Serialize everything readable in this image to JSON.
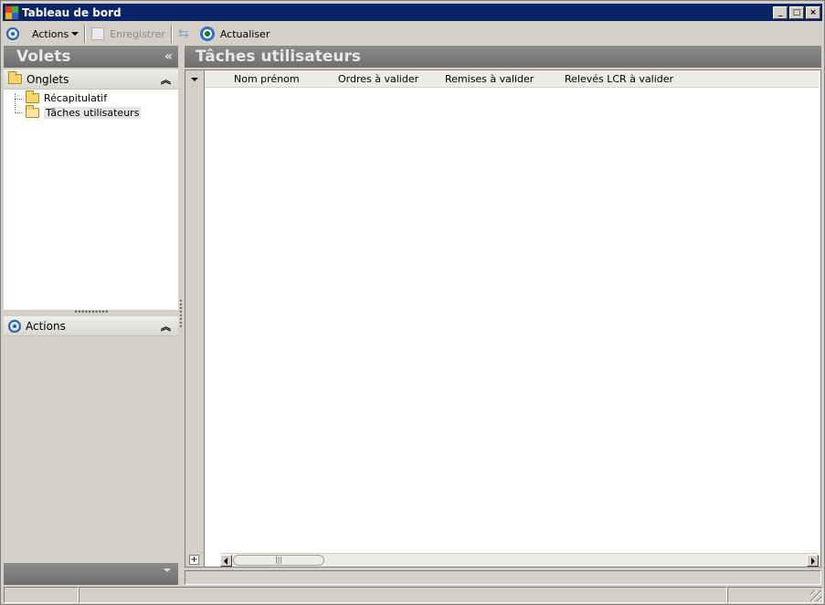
{
  "window": {
    "title": "Tableau de bord"
  },
  "toolbar": {
    "actions_label": "Actions",
    "save_label": "Enregistrer",
    "refresh_label": "Actualiser"
  },
  "left": {
    "header": "Volets",
    "collapse_glyph": "«",
    "tabs_section": {
      "title": "Onglets",
      "items": [
        {
          "label": "Récapitulatif"
        },
        {
          "label": "Tâches utilisateurs",
          "selected": true
        }
      ]
    },
    "actions_section": {
      "title": "Actions"
    }
  },
  "main": {
    "title": "Tâches utilisateurs",
    "columns": [
      "Nom prénom",
      "Ordres à valider",
      "Remises à valider",
      "Relevés LCR à valider"
    ]
  },
  "colors": {
    "title_bar": "#0a246a",
    "panel_header": "#7d7d7d",
    "accent": "#2c5fb3"
  }
}
